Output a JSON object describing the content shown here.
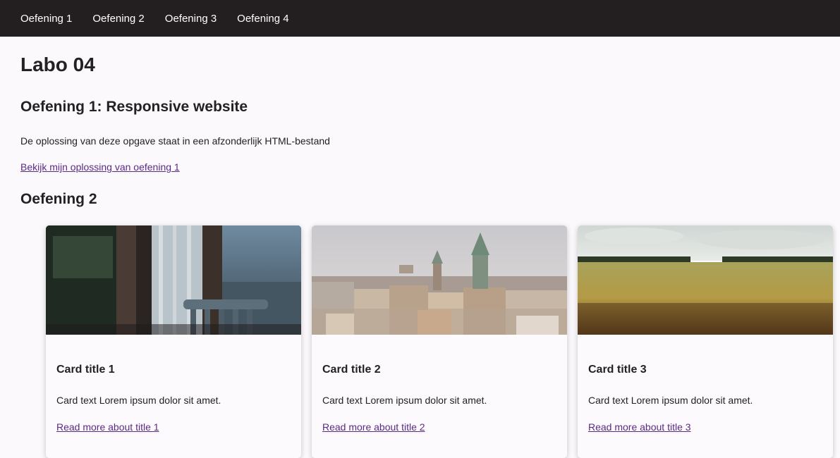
{
  "nav": {
    "items": [
      "Oefening 1",
      "Oefening 2",
      "Oefening 3",
      "Oefening 4"
    ]
  },
  "page": {
    "title": "Labo 04"
  },
  "section1": {
    "heading": "Oefening 1: Responsive website",
    "description": "De oplossing van deze opgave staat in een afzonderlijk HTML-bestand",
    "link_text": "Bekijk mijn oplossing van oefening 1"
  },
  "section2": {
    "heading": "Oefening 2",
    "cards": [
      {
        "title": "Card title 1",
        "text": "Card text Lorem ipsum dolor sit amet.",
        "link": "Read more about title 1",
        "image": "window-chair-photo"
      },
      {
        "title": "Card title 2",
        "text": "Card text Lorem ipsum dolor sit amet.",
        "link": "Read more about title 2",
        "image": "city-skyline-photo"
      },
      {
        "title": "Card title 3",
        "text": "Card text Lorem ipsum dolor sit amet.",
        "link": "Read more about title 3",
        "image": "wheat-field-photo"
      }
    ]
  },
  "colors": {
    "nav_bg": "#231f20",
    "page_bg": "#fcf9fc",
    "link": "#5b2a86"
  }
}
